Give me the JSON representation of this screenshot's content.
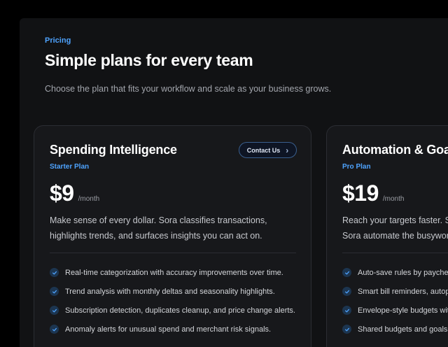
{
  "header": {
    "eyebrow": "Pricing",
    "title": "Simple plans for every team",
    "subtitle": "Choose the plan that fits your workflow and scale as your business grows."
  },
  "plans": [
    {
      "name": "Spending Intelligence",
      "tier": "Starter Plan",
      "price": "$9",
      "period": "/month",
      "cta": "Contact Us",
      "description_lines": [
        "Make sense of every dollar. Sora classifies transactions,",
        "highlights trends, and surfaces insights you can act on."
      ],
      "features": [
        "Real-time categorization with accuracy improvements over time.",
        "Trend analysis with monthly deltas and seasonality highlights.",
        "Subscription detection, duplicates cleanup, and price change alerts.",
        "Anomaly alerts for unusual spend and merchant risk signals."
      ]
    },
    {
      "name": "Automation & Goa",
      "tier": "Pro Plan",
      "price": "$19",
      "period": "/month",
      "description_lines": [
        "Reach your targets faster. Se",
        "Sora automate the busywork"
      ],
      "features": [
        "Auto-save rules by payche",
        "Smart bill reminders, autop",
        "Envelope-style budgets wit",
        "Shared budgets and goals"
      ]
    }
  ],
  "icons": {
    "check": "check-circle-icon",
    "chevron": "chevron-right-icon"
  },
  "colors": {
    "accent": "#4ea3ff",
    "background": "#111214",
    "card": "#17181b",
    "border": "#2b2d33"
  }
}
